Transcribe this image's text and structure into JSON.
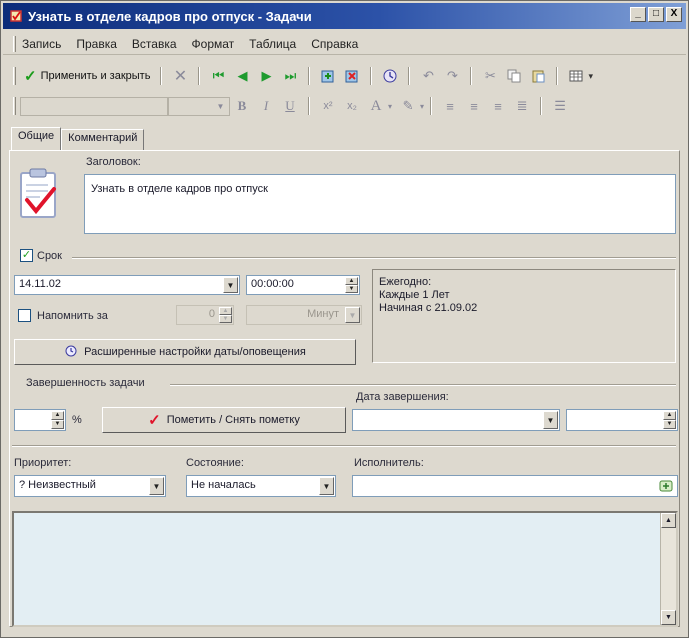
{
  "window": {
    "title": "Узнать в отделе кадров про отпуск - Задачи",
    "buttons": [
      "_",
      "□",
      "X"
    ]
  },
  "menubar": {
    "items": [
      "Запись",
      "Правка",
      "Вставка",
      "Формат",
      "Таблица",
      "Справка"
    ]
  },
  "toolbar": {
    "apply_close_label": "Применить и закрыть"
  },
  "tabs": [
    "Общие",
    "Комментарий"
  ],
  "task": {
    "subject_label": "Заголовок:",
    "subject_value": "Узнать в отделе кадров про отпуск"
  },
  "due": {
    "checkbox_label": "Срок",
    "date_value": "14.11.02",
    "time_value": "00:00:00",
    "recurrence_lines": [
      "Ежегодно:",
      "Каждые 1 Лет",
      "Начиная с 21.09.02"
    ],
    "remind_label": "Напомнить за",
    "remind_count": "0",
    "remind_unit": "Минут",
    "advanced_button": "Расширенные настройки даты/оповещения"
  },
  "completion": {
    "group_label": "Завершенность задачи",
    "percent_sign": "%",
    "mark_button": "Пометить / Снять пометку",
    "completion_date_label": "Дата завершения:"
  },
  "status": {
    "priority_label": "Приоритет:",
    "priority_value": "? Неизвестный",
    "state_label": "Состояние:",
    "state_value": "Не началась",
    "assignee_label": "Исполнитель:"
  }
}
